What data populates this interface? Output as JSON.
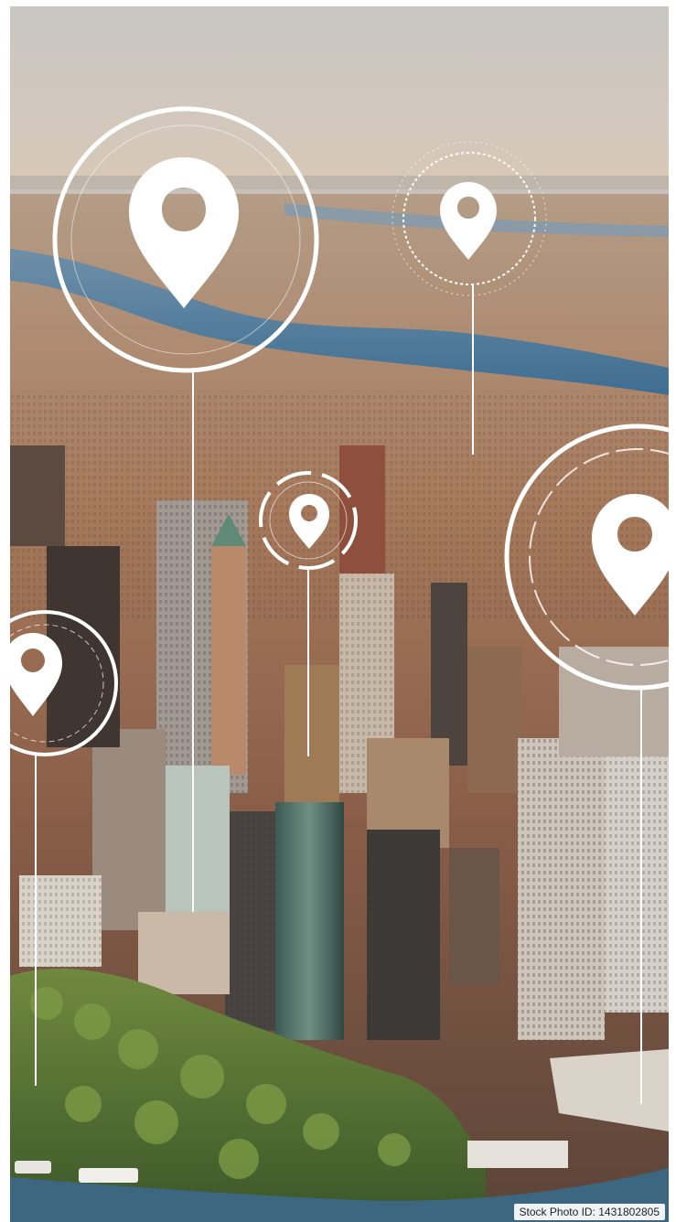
{
  "photo": {
    "subject": "aerial city skyline with location pin markers",
    "pins": [
      {
        "name": "location-pin-icon-large-top-left"
      },
      {
        "name": "location-pin-icon-top-right"
      },
      {
        "name": "location-pin-icon-center"
      },
      {
        "name": "location-pin-icon-right"
      },
      {
        "name": "location-pin-icon-left"
      }
    ],
    "colors": {
      "sky": "#cfc6bc",
      "water": "#3b6f94",
      "city_warm": "#b07a56",
      "city_shadow": "#4b3b34",
      "park": "#5e7a3a",
      "pin": "#ffffff"
    }
  },
  "watermark": {
    "text": "Stock Photo ID: 1431802805"
  }
}
